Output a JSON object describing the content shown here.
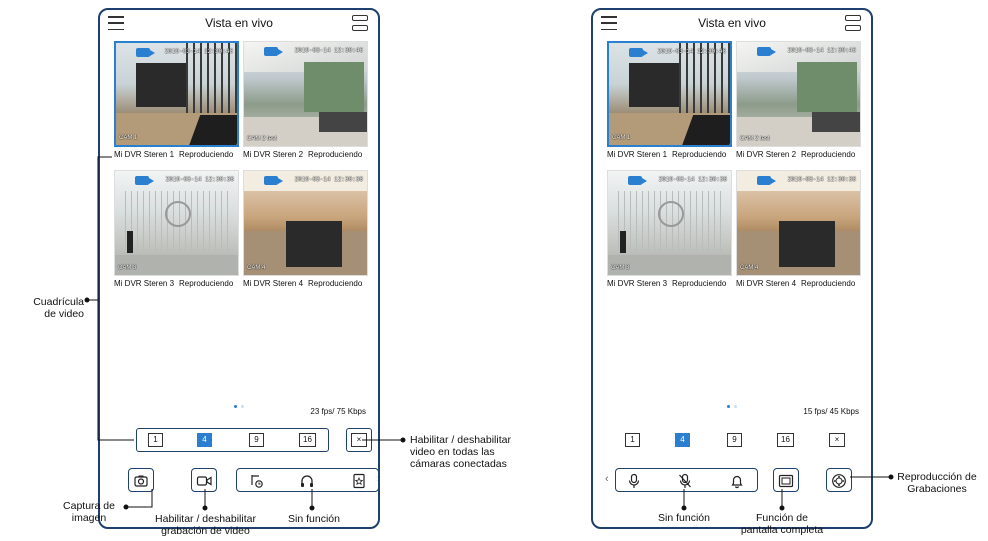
{
  "left_phone": {
    "title": "Vista en vivo",
    "cams": [
      {
        "timestamp": "2019-03-14 12:30:46",
        "label": "CAM 1",
        "caption": "Mi DVR Steren 1",
        "status": "Reproduciendo"
      },
      {
        "timestamp": "2019-03-14 12:30:46",
        "label": "CAM 2 test",
        "caption": "Mi DVR Steren 2",
        "status": "Reproduciendo"
      },
      {
        "timestamp": "2019-03-14 12:30:38",
        "label": "CAM 3",
        "caption": "Mi DVR Steren 3",
        "status": "Reproduciendo"
      },
      {
        "timestamp": "2019-03-14 12:30:38",
        "label": "CAM 4",
        "caption": "Mi DVR Steren 4",
        "status": "Reproduciendo"
      }
    ],
    "fps": "23 fps/ 75 Kbps",
    "layouts": [
      "1",
      "4",
      "9",
      "16"
    ],
    "toolbar_icons": [
      "camera-icon",
      "video-record-icon",
      "ptz-icon",
      "headphones-icon",
      "bookmark-icon"
    ]
  },
  "right_phone": {
    "title": "Vista en vivo",
    "cams": [
      {
        "timestamp": "2019-03-14 12:30:46",
        "label": "CAM 1",
        "caption": "Mi DVR Steren 1",
        "status": "Reproduciendo"
      },
      {
        "timestamp": "2019-03-14 12:30:46",
        "label": "CAM 2 test",
        "caption": "Mi DVR Steren 2",
        "status": "Reproduciendo"
      },
      {
        "timestamp": "2019-03-14 12:30:38",
        "label": "CAM 3",
        "caption": "Mi DVR Steren 3",
        "status": "Reproduciendo"
      },
      {
        "timestamp": "2019-03-14 12:30:38",
        "label": "CAM 4",
        "caption": "Mi DVR Steren 4",
        "status": "Reproduciendo"
      }
    ],
    "fps": "15 fps/ 45 Kbps",
    "layouts": [
      "1",
      "4",
      "9",
      "16"
    ],
    "toolbar_icons": [
      "microphone-icon",
      "mute-mic-icon",
      "bell-icon",
      "fullscreen-icon",
      "playback-icon"
    ]
  },
  "annotations": {
    "grid": "Cuadrícula\nde video",
    "toggle_all": "Habilitar / deshabilitar\nvideo en todas las\ncámaras conectadas",
    "capture": "Captura de\nimagen",
    "record": "Habilitar / deshabilitar\ngrabación de video",
    "no_function_left": "Sin función",
    "no_function_right": "Sin función",
    "fullscreen": "Función de\npantalla completa",
    "playback": "Reproducción de\nGrabaciones"
  },
  "colors": {
    "accent": "#2b7fd1",
    "frame": "#1f3f6e"
  }
}
